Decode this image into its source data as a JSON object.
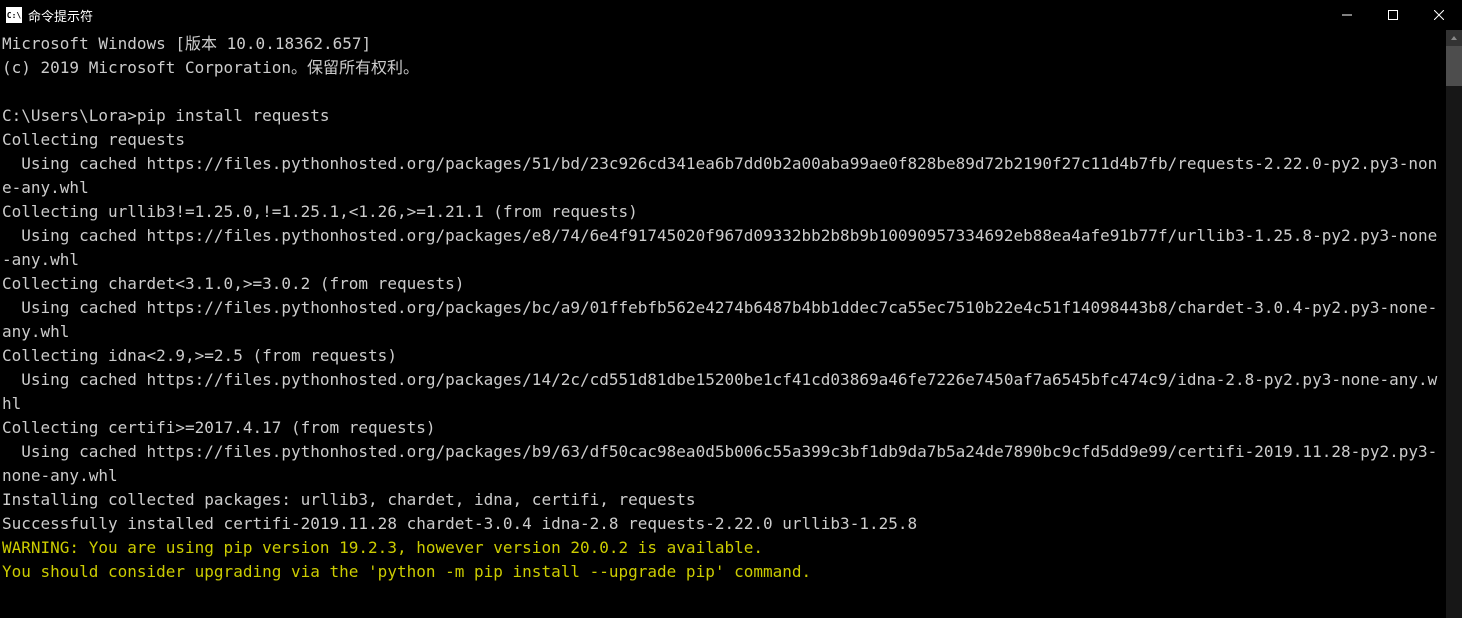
{
  "titlebar": {
    "icon_text": "C:\\",
    "title": "命令提示符"
  },
  "terminal": {
    "lines": [
      {
        "text": "Microsoft Windows [版本 10.0.18362.657]",
        "class": ""
      },
      {
        "text": "(c) 2019 Microsoft Corporation。保留所有权利。",
        "class": ""
      },
      {
        "text": "",
        "class": ""
      },
      {
        "text": "C:\\Users\\Lora>pip install requests",
        "class": ""
      },
      {
        "text": "Collecting requests",
        "class": ""
      },
      {
        "text": "  Using cached https://files.pythonhosted.org/packages/51/bd/23c926cd341ea6b7dd0b2a00aba99ae0f828be89d72b2190f27c11d4b7fb/requests-2.22.0-py2.py3-none-any.whl",
        "class": ""
      },
      {
        "text": "Collecting urllib3!=1.25.0,!=1.25.1,<1.26,>=1.21.1 (from requests)",
        "class": ""
      },
      {
        "text": "  Using cached https://files.pythonhosted.org/packages/e8/74/6e4f91745020f967d09332bb2b8b9b10090957334692eb88ea4afe91b77f/urllib3-1.25.8-py2.py3-none-any.whl",
        "class": ""
      },
      {
        "text": "Collecting chardet<3.1.0,>=3.0.2 (from requests)",
        "class": ""
      },
      {
        "text": "  Using cached https://files.pythonhosted.org/packages/bc/a9/01ffebfb562e4274b6487b4bb1ddec7ca55ec7510b22e4c51f14098443b8/chardet-3.0.4-py2.py3-none-any.whl",
        "class": ""
      },
      {
        "text": "Collecting idna<2.9,>=2.5 (from requests)",
        "class": ""
      },
      {
        "text": "  Using cached https://files.pythonhosted.org/packages/14/2c/cd551d81dbe15200be1cf41cd03869a46fe7226e7450af7a6545bfc474c9/idna-2.8-py2.py3-none-any.whl",
        "class": ""
      },
      {
        "text": "Collecting certifi>=2017.4.17 (from requests)",
        "class": ""
      },
      {
        "text": "  Using cached https://files.pythonhosted.org/packages/b9/63/df50cac98ea0d5b006c55a399c3bf1db9da7b5a24de7890bc9cfd5dd9e99/certifi-2019.11.28-py2.py3-none-any.whl",
        "class": ""
      },
      {
        "text": "Installing collected packages: urllib3, chardet, idna, certifi, requests",
        "class": ""
      },
      {
        "text": "Successfully installed certifi-2019.11.28 chardet-3.0.4 idna-2.8 requests-2.22.0 urllib3-1.25.8",
        "class": ""
      },
      {
        "text": "WARNING: You are using pip version 19.2.3, however version 20.0.2 is available.",
        "class": "warning"
      },
      {
        "text": "You should consider upgrading via the 'python -m pip install --upgrade pip' command.",
        "class": "warning"
      }
    ]
  }
}
